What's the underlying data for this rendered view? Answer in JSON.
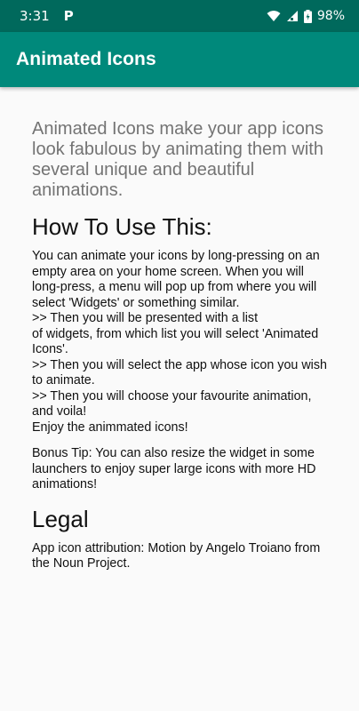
{
  "status_bar": {
    "time": "3:31",
    "notification_icon": "p-icon",
    "battery_percent": "98%",
    "icons": [
      "wifi-icon",
      "signal-icon",
      "battery-icon"
    ]
  },
  "app_bar": {
    "title": "Animated Icons",
    "color": "#00897b",
    "status_color": "#00695c"
  },
  "main": {
    "intro": "Animated Icons make your app icons look fabulous by animating them with several unique and beautiful animations.",
    "how_to_heading": "How To Use This:",
    "how_to_body": "You can animate your icons by long-pressing on an empty area on your home screen. When you will long-press, a menu will pop up from where you will select 'Widgets' or something similar.\n>> Then you will be presented with a list\nof widgets, from which list you will select 'Animated Icons'.\n>> Then you will select the app whose icon you wish to animate.\n>> Then you will choose your favourite animation, and voila!\nEnjoy the animmated icons!",
    "bonus_tip": "Bonus Tip: You can also resize the widget in some launchers to enjoy super large icons with more HD animations!",
    "legal_heading": "Legal",
    "legal_body": "App icon attribution: Motion by Angelo Troiano from the Noun Project."
  }
}
